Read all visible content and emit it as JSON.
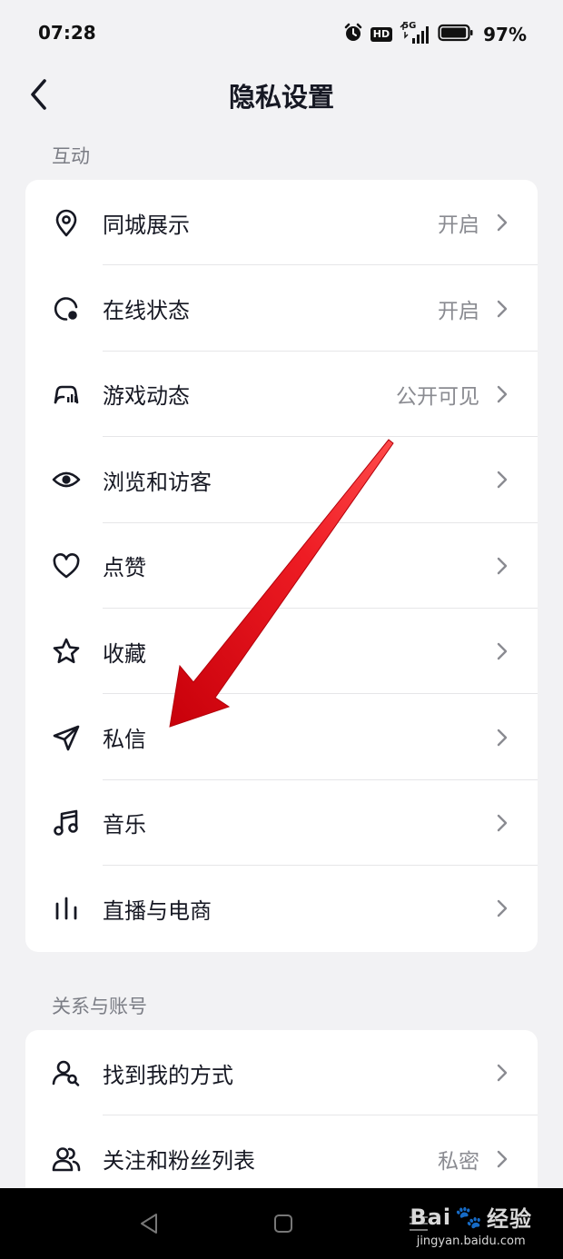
{
  "status_bar": {
    "time": "07:28",
    "hd": "HD",
    "network": "5G",
    "battery_pct": "97%",
    "battery_level": 0.97
  },
  "nav": {
    "title": "隐私设置"
  },
  "sections": [
    {
      "title": "互动",
      "items": [
        {
          "label": "同城展示",
          "value": "开启",
          "icon": "location-pin-icon"
        },
        {
          "label": "在线状态",
          "value": "开启",
          "icon": "online-status-icon"
        },
        {
          "label": "游戏动态",
          "value": "公开可见",
          "icon": "gamepad-icon"
        },
        {
          "label": "浏览和访客",
          "value": "",
          "icon": "eye-icon"
        },
        {
          "label": "点赞",
          "value": "",
          "icon": "heart-icon"
        },
        {
          "label": "收藏",
          "value": "",
          "icon": "star-icon"
        },
        {
          "label": "私信",
          "value": "",
          "icon": "paper-plane-icon"
        },
        {
          "label": "音乐",
          "value": "",
          "icon": "music-note-icon"
        },
        {
          "label": "直播与电商",
          "value": "",
          "icon": "bars-icon"
        }
      ]
    },
    {
      "title": "关系与账号",
      "items": [
        {
          "label": "找到我的方式",
          "value": "",
          "icon": "user-search-icon"
        },
        {
          "label": "关注和粉丝列表",
          "value": "私密",
          "icon": "users-icon"
        }
      ]
    }
  ],
  "watermark": {
    "brand": "Bai",
    "brand_cn": "经验",
    "url": "jingyan.baidu.com"
  },
  "colors": {
    "background": "#f2f2f4",
    "card": "#ffffff",
    "text": "#161823",
    "secondary_text": "#8a8b91",
    "annotation_arrow": "#e8141c"
  }
}
